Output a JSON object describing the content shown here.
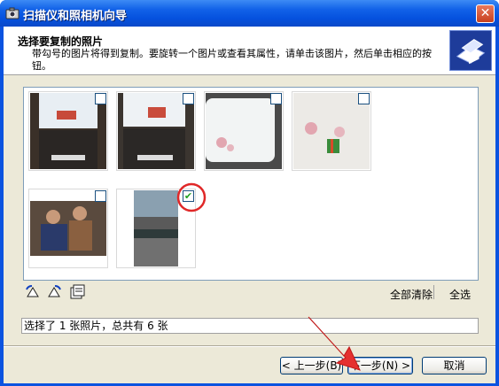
{
  "window": {
    "title": "扫描仪和照相机向导",
    "close_glyph": "✕"
  },
  "header": {
    "title": "选择要复制的照片",
    "description": "带勾号的图片将得到复制。要旋转一个图片或查看其属性，请单击该图片，然后单击相应的按钮。"
  },
  "photos": [
    {
      "name": "photo-1",
      "checked": false
    },
    {
      "name": "photo-2",
      "checked": false
    },
    {
      "name": "photo-3",
      "checked": false
    },
    {
      "name": "photo-4",
      "checked": false
    },
    {
      "name": "photo-5",
      "checked": false
    },
    {
      "name": "photo-6",
      "checked": true
    }
  ],
  "check_glyph": "✔",
  "toolbar": {
    "rotate_left_icon": "rotate-left-icon",
    "rotate_right_icon": "rotate-right-icon",
    "properties_icon": "properties-icon",
    "clear_all_label": "全部清除",
    "select_all_label": "全选"
  },
  "status": {
    "text": "选择了 1 张照片，总共有 6 张"
  },
  "buttons": {
    "back_label": "< 上一步(B)",
    "next_label": "下一步(N) >",
    "cancel_label": "取消"
  },
  "colors": {
    "titlebar": "#0551de",
    "panel_border": "#7f9db9",
    "check_green": "#21a121"
  }
}
